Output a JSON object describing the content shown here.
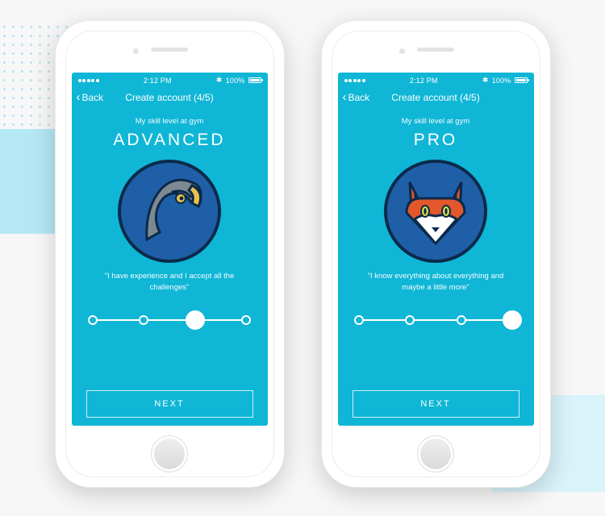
{
  "statusbar": {
    "carrier_dots": 5,
    "time": "2:12 PM",
    "bt": "100%"
  },
  "nav": {
    "back_label": "Back",
    "title": "Create account (4/5)"
  },
  "common": {
    "subtitle": "My skill level at gym",
    "next_label": "NEXT"
  },
  "screens": [
    {
      "level": "ADVANCED",
      "quote": "\"I have experience and I accept all the challenges\"",
      "slider_positions": [
        0,
        33.3,
        66.6,
        100
      ],
      "slider_selected_index": 2,
      "avatar": "eagle"
    },
    {
      "level": "PRO",
      "quote": "\"I know everything about everything and maybe a little more\"",
      "slider_positions": [
        0,
        33.3,
        66.6,
        100
      ],
      "slider_selected_index": 3,
      "avatar": "fox"
    }
  ]
}
